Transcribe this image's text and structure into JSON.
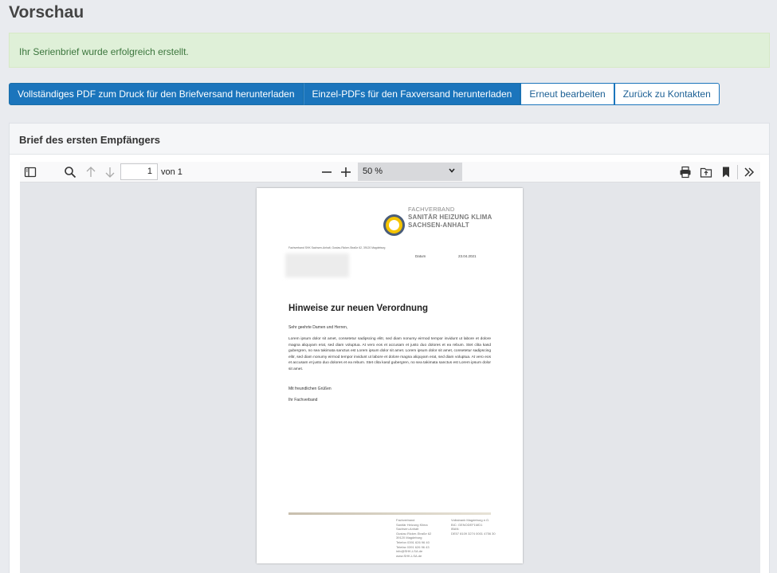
{
  "page": {
    "title": "Vorschau"
  },
  "alert": {
    "message": "Ihr Serienbrief wurde erfolgreich erstellt."
  },
  "actions": {
    "download_full_pdf": "Vollständiges PDF zum Druck für den Briefversand herunterladen",
    "download_single_pdfs": "Einzel-PDFs für den Faxversand herunterladen",
    "edit_again": "Erneut bearbeiten",
    "back_to_contacts": "Zurück zu Kontakten"
  },
  "panel": {
    "heading": "Brief des ersten Empfängers"
  },
  "viewer": {
    "page_number": "1",
    "page_of": "von 1",
    "zoom": "50 %",
    "icons": [
      "sidebar-toggle-icon",
      "search-icon",
      "arrow-up-icon",
      "arrow-down-icon",
      "minus-icon",
      "plus-icon",
      "chevron-down-icon",
      "print-icon",
      "open-file-icon",
      "bookmark-icon",
      "double-chevron-right-icon"
    ]
  },
  "letter": {
    "org_line1": "FACHVERBAND",
    "org_line2": "SANITÄR HEIZUNG KLIMA",
    "org_line3": "SACHSEN-ANHALT",
    "sender_line": "Fachverband SHK Sachsen-Anhalt, Gustav-Ricker-Straße 62, 39120 Magdeburg",
    "date_label": "Datum",
    "date_value": "23.04.2021",
    "heading": "Hinweise zur neuen Verordnung",
    "salutation": "Sehr geehrte Damen und Herren,",
    "body": "Lorem ipsum dolor sit amet, consetetur sadipscing elitr, sed diam nonumy eirmod tempor invidunt ut labore et dolore magna aliquyam erat, sed diam voluptua. At vero eos et accusam et justo duo dolores et ea rebum. Stet clita kasd gubergren, no sea takimata sanctus est Lorem ipsum dolor sit amet. Lorem ipsum dolor sit amet, consetetur sadipscing elitr, sed diam nonumy eirmod tempor invidunt ut labore et dolore magna aliquyam erat, sed diam voluptua. At vero eos et accusam et justo duo dolores et ea rebum. Stet clita kasd gubergren, no sea takimata sanctus est Lorem ipsum dolor sit amet.",
    "closing": "Mit freundlichen Grüßen",
    "signature": "Ihr Fachverband",
    "footer_col1": "Fachverband\nSanitär Heizung Klima\nSachsen-Anhalt\nGustav-Ricker-Straße 62\n39120 Magdeburg\nTelefon 0391 626 96 40\nTelefax 0391 626 96 43\ninfo@SHK-LSA.de\nwww.SHK-LSA.de",
    "footer_col2": "Volksbank Magdeburg e.G.\nBIC: GENODEF1MD1\nIBAN:\nDE57 8109 3274 0001 4756 30"
  },
  "colors": {
    "primary": "#1b75bc",
    "success_bg": "#dff0d8",
    "success_text": "#3c763d"
  }
}
